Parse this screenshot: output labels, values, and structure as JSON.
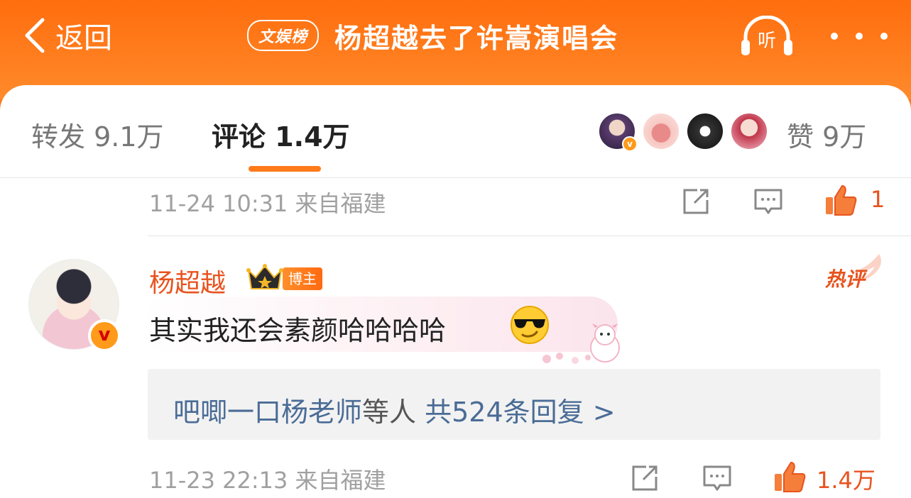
{
  "header": {
    "back_label": "返回",
    "rank_badge": "文娱榜",
    "title": "杨超越去了许嵩演唱会",
    "listen_label": "听"
  },
  "tabs": {
    "repost": "转发 9.1万",
    "comment": "评论 1.4万",
    "likes": "赞 9万"
  },
  "comments": [
    {
      "time": "11-24 10:31",
      "source": "来自福建",
      "like_count": "1"
    },
    {
      "username": "杨超越",
      "role_badge": "博主",
      "hot_tag": "热评",
      "text": "其实我还会素颜哈哈哈哈",
      "replies": {
        "names": "吧唧一口杨老师",
        "etc": "等人",
        "count": "共524条回复 >"
      },
      "time": "11-23 22:13",
      "source": "来自福建",
      "like_count": "1.4万"
    }
  ],
  "colors": {
    "brand_orange": "#ff7a1a",
    "name_orange": "#e8531e",
    "link_blue": "#4a6c96"
  }
}
